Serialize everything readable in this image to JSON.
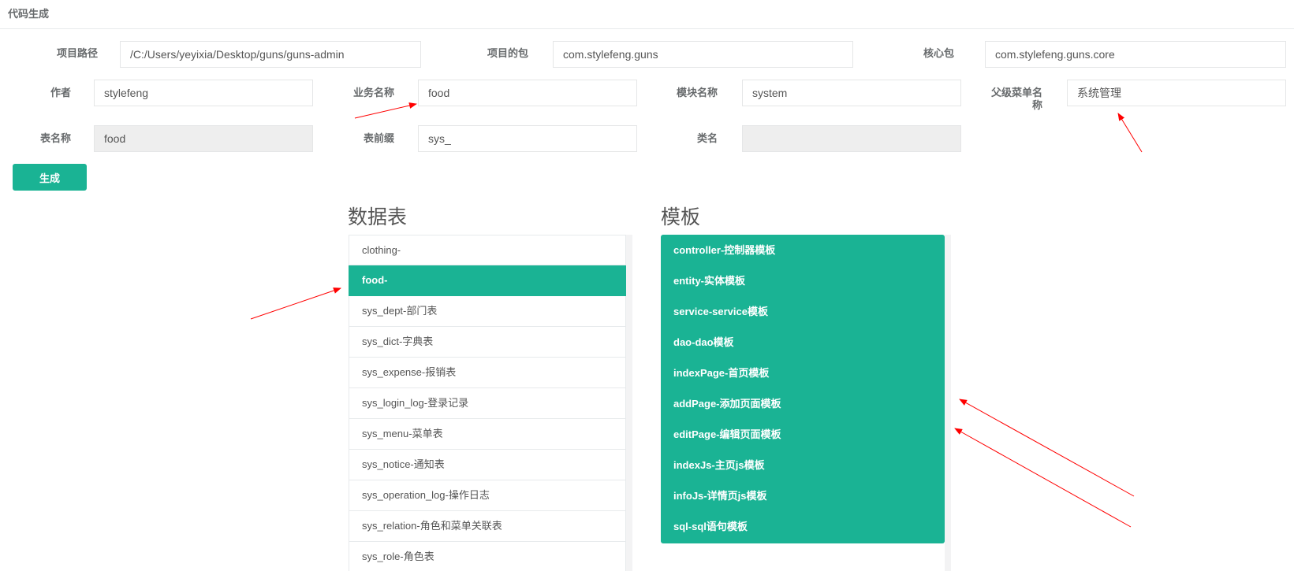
{
  "panel": {
    "title": "代码生成"
  },
  "form": {
    "project_path": {
      "label": "项目路径",
      "value": "/C:/Users/yeyixia/Desktop/guns/guns-admin"
    },
    "project_package": {
      "label": "项目的包",
      "value": "com.stylefeng.guns"
    },
    "core_package": {
      "label": "核心包",
      "value": "com.stylefeng.guns.core"
    },
    "author": {
      "label": "作者",
      "value": "stylefeng"
    },
    "biz_name": {
      "label": "业务名称",
      "value": "food"
    },
    "module_name": {
      "label": "模块名称",
      "value": "system"
    },
    "parent_menu": {
      "label_line1": "父级菜单名",
      "label_line2": "称",
      "value": "系统管理"
    },
    "table_name": {
      "label": "表名称",
      "value": "food"
    },
    "table_prefix": {
      "label": "表前缀",
      "value": "sys_"
    },
    "class_name": {
      "label": "类名",
      "value": ""
    },
    "generate_label": "生成"
  },
  "tables": {
    "title": "数据表",
    "items": [
      "clothing-",
      "food-",
      "sys_dept-部门表",
      "sys_dict-字典表",
      "sys_expense-报销表",
      "sys_login_log-登录记录",
      "sys_menu-菜单表",
      "sys_notice-通知表",
      "sys_operation_log-操作日志",
      "sys_relation-角色和菜单关联表",
      "sys_role-角色表"
    ],
    "selected": "food-"
  },
  "templates": {
    "title": "模板",
    "items": [
      "controller-控制器模板",
      "entity-实体模板",
      "service-service模板",
      "dao-dao模板",
      "indexPage-首页模板",
      "addPage-添加页面模板",
      "editPage-编辑页面模板",
      "indexJs-主页js模板",
      "infoJs-详情页js模板",
      "sql-sql语句模板"
    ]
  },
  "colors": {
    "accent": "#1ab394",
    "annotation": "#ff0000"
  }
}
